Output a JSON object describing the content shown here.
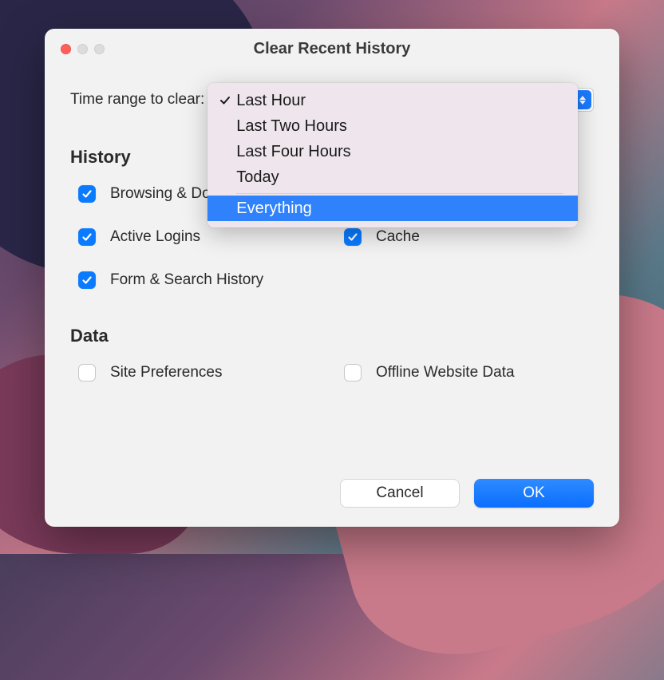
{
  "window": {
    "title": "Clear Recent History"
  },
  "time_range": {
    "label": "Time range to clear:",
    "options": [
      "Last Hour",
      "Last Two Hours",
      "Last Four Hours",
      "Today",
      "Everything"
    ],
    "selected_index": 0,
    "highlighted_index": 4
  },
  "sections": {
    "history": {
      "title": "History",
      "items": [
        {
          "label": "Browsing & Download History",
          "checked": true
        },
        {
          "label": "Active Logins",
          "checked": true
        },
        {
          "label": "Cache",
          "checked": true
        },
        {
          "label": "Form & Search History",
          "checked": true
        }
      ]
    },
    "data": {
      "title": "Data",
      "items": [
        {
          "label": "Site Preferences",
          "checked": false
        },
        {
          "label": "Offline Website Data",
          "checked": false
        }
      ]
    }
  },
  "buttons": {
    "cancel": "Cancel",
    "ok": "OK"
  }
}
